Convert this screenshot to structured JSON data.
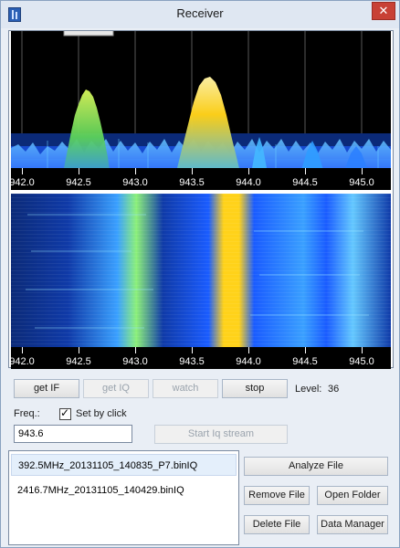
{
  "window": {
    "title": "Receiver",
    "close_glyph": "✕"
  },
  "spectrum": {
    "tick_labels": [
      "942.0",
      "942.5",
      "943.0",
      "943.5",
      "944.0",
      "944.5",
      "945.0"
    ],
    "level_markers": [
      {
        "freq": "943.6",
        "color": "#ffd21a"
      },
      {
        "freq": "942.5",
        "color": "#ffd21a"
      }
    ]
  },
  "controls": {
    "get_if": "get IF",
    "get_iq": "get IQ",
    "watch": "watch",
    "stop": "stop",
    "level_label": "Level:",
    "level_value": "36",
    "freq_label": "Freq.:",
    "freq_value": "943.6",
    "set_by_click_label": "Set by click",
    "start_iq_stream": "Start Iq stream"
  },
  "files": {
    "items": [
      "392.5MHz_20131105_140835_P7.binIQ",
      "2416.7MHz_20131105_140429.binIQ"
    ],
    "selected_index": 0
  },
  "file_buttons": {
    "analyze": "Analyze File",
    "remove": "Remove File",
    "open_folder": "Open Folder",
    "delete": "Delete File",
    "data_manager": "Data Manager"
  },
  "colors": {
    "accent": "#2a5fb5",
    "close": "#c84135",
    "spectrum_bg": "#000000",
    "waterfall_bg": "#0a1a6a",
    "hot": "#ffd21a",
    "warm": "#a8e24b",
    "cool": "#3aa0ff"
  }
}
